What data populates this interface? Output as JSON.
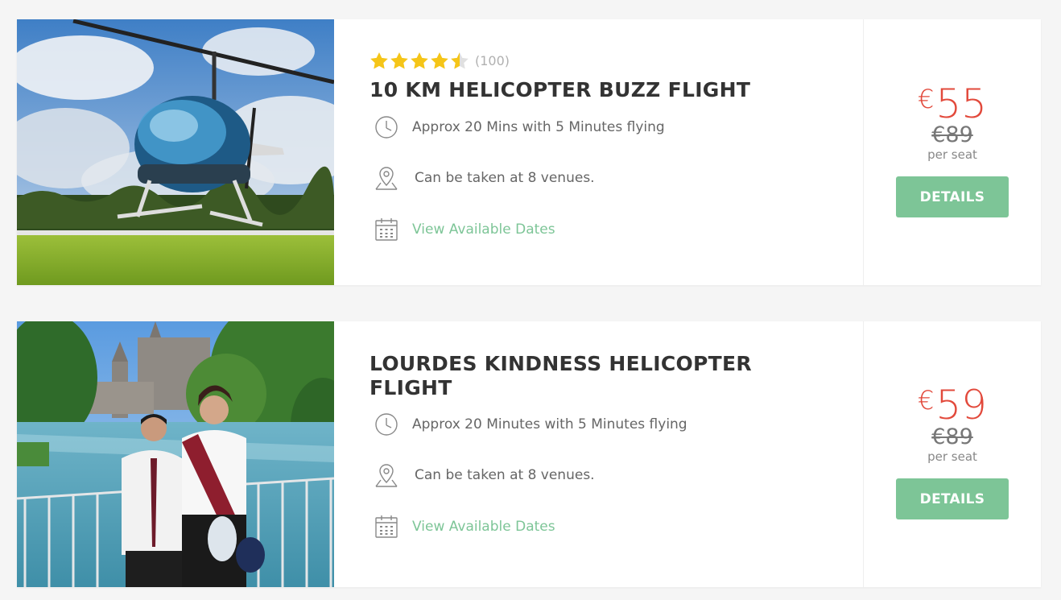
{
  "colors": {
    "accent_green": "#7dc597",
    "price_red": "#e2493b",
    "star_gold": "#f5c518"
  },
  "flights": [
    {
      "rating_stars": 4.5,
      "rating_count": "(100)",
      "title": "10 KM HELICOPTER BUZZ FLIGHT",
      "duration": "Approx 20 Mins with 5 Minutes flying",
      "venues": "Can be taken at 8 venues.",
      "dates_link": "View Available Dates",
      "currency": "€",
      "price": "55",
      "old_price": "€89",
      "per_seat": "per seat",
      "details_label": "DETAILS",
      "icons": {
        "duration": "clock-icon",
        "venues": "map-pin-icon",
        "dates": "calendar-icon"
      }
    },
    {
      "title": "LOURDES KINDNESS HELICOPTER FLIGHT",
      "duration": "Approx 20 Minutes with 5 Minutes flying",
      "venues": "Can be taken at 8 venues.",
      "dates_link": "View Available Dates",
      "currency": "€",
      "price": "59",
      "old_price": "€89",
      "per_seat": "per seat",
      "details_label": "DETAILS",
      "icons": {
        "duration": "clock-icon",
        "venues": "map-pin-icon",
        "dates": "calendar-icon"
      }
    }
  ]
}
